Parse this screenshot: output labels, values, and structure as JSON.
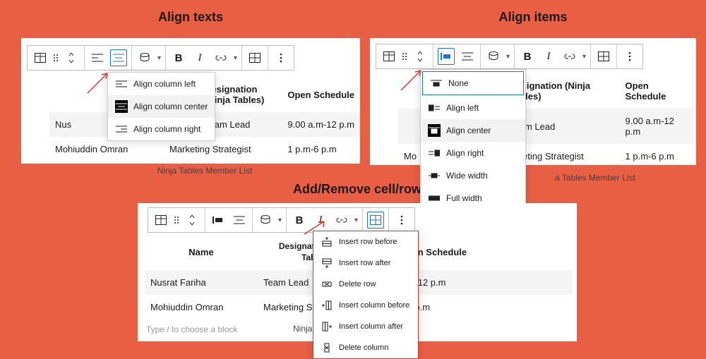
{
  "titles": {
    "p1": "Align texts",
    "p2": "Align items",
    "p3": "Add/Remove cell/row"
  },
  "toolbar": {
    "bold": "B",
    "italic": "I"
  },
  "table": {
    "headers": {
      "name": "Name",
      "designation": "Designation (Ninja Tables)",
      "schedule": "Open Schedule"
    },
    "header_name_short": "Name",
    "header_designation_p3": "Designation (Ninja Tables)",
    "rows": [
      {
        "name": "Nusrat Fariha",
        "designation": "Team Lead",
        "schedule": "9.00 a.m-12 p.m"
      },
      {
        "name": "Mohiuddin Omran",
        "designation": "Marketing Strategist",
        "schedule": "1 p.m-6 p.m"
      }
    ],
    "p1_row0_name_clipped": "Nus",
    "p2_row1_name_clipped": "Mo",
    "p2_row1_desig_clipped": "arketing Strategist",
    "p2_caption_clipped": "a Tables Member List",
    "p3_row1_sched_clipped": "6 p.m",
    "p3_row0_sched_clipped": "m-12 p.m",
    "caption": "Ninja Tables Member List"
  },
  "dd_text_align": [
    {
      "label": "Align column left"
    },
    {
      "label": "Align column center"
    },
    {
      "label": "Align column right"
    }
  ],
  "dd_item_align": [
    {
      "label": "None"
    },
    {
      "label": "Align left"
    },
    {
      "label": "Align center"
    },
    {
      "label": "Align right"
    },
    {
      "label": "Wide width"
    },
    {
      "label": "Full width"
    }
  ],
  "dd_table_ops": [
    {
      "label": "Insert row before"
    },
    {
      "label": "Insert row after"
    },
    {
      "label": "Delete row"
    },
    {
      "label": "Insert column before"
    },
    {
      "label": "Insert column after"
    },
    {
      "label": "Delete column"
    }
  ],
  "placeholder_text": "Type / to choose a block"
}
